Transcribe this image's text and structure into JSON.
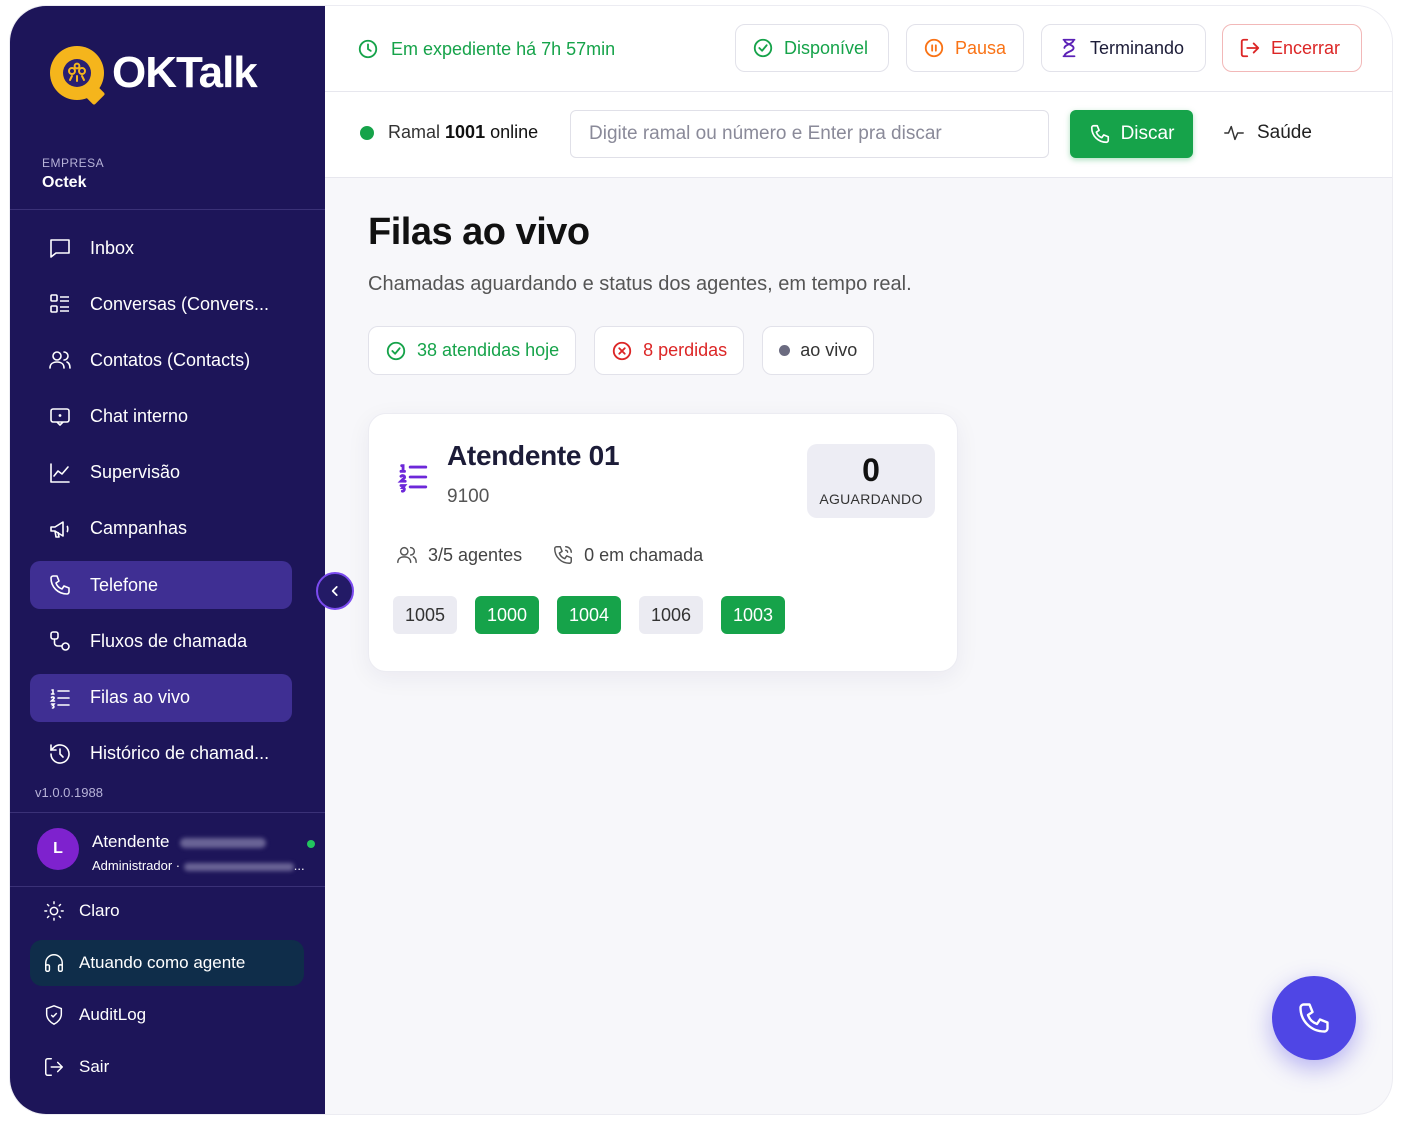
{
  "brand": {
    "name": "OKTalk"
  },
  "company": {
    "label": "EMPRESA",
    "name": "Octek"
  },
  "sidebar": {
    "items": [
      {
        "label": "Inbox",
        "icon": "message-square-icon",
        "active": false
      },
      {
        "label": "Conversas (Convers...",
        "icon": "list-grid-icon",
        "active": false
      },
      {
        "label": "Contatos (Contacts)",
        "icon": "users-icon",
        "active": false
      },
      {
        "label": "Chat interno",
        "icon": "chat-bubble-icon",
        "active": false
      },
      {
        "label": "Supervisão",
        "icon": "line-chart-icon",
        "active": false
      },
      {
        "label": "Campanhas",
        "icon": "megaphone-icon",
        "active": false
      },
      {
        "label": "Telefone",
        "icon": "phone-icon",
        "active": true
      },
      {
        "label": "Fluxos de chamada",
        "icon": "route-icon",
        "active": false
      },
      {
        "label": "Filas ao vivo",
        "icon": "list-ordered-icon",
        "active": true
      },
      {
        "label": "Histórico de chamad...",
        "icon": "history-icon",
        "active": false
      }
    ],
    "version": "v1.0.0.1988"
  },
  "user": {
    "initial": "L",
    "name": "Atendente",
    "role": "Administrador ·",
    "role_suffix": "..."
  },
  "bottom_nav": {
    "theme": "Claro",
    "agent_mode": "Atuando como agente",
    "audit": "AuditLog",
    "logout": "Sair"
  },
  "topbar": {
    "shift": "Em expediente há 7h 57min",
    "available": "Disponível",
    "pause": "Pausa",
    "finishing": "Terminando",
    "end": "Encerrar"
  },
  "dialbar": {
    "ramal_prefix": "Ramal",
    "ramal_number": "1001",
    "ramal_status": "online",
    "input_placeholder": "Digite ramal ou número e Enter pra discar",
    "input_value": "",
    "dial": "Discar",
    "health": "Saúde"
  },
  "page": {
    "title": "Filas ao vivo",
    "subtitle": "Chamadas aguardando e status dos agentes, em tempo real."
  },
  "chips": {
    "answered": "38 atendidas hoje",
    "missed": "8 perdidas",
    "live": "ao vivo"
  },
  "queue": {
    "name": "Atendente 01",
    "number": "9100",
    "waiting": "0",
    "waiting_label": "AGUARDANDO",
    "agents": "3/5 agentes",
    "in_call": "0 em chamada",
    "extensions": [
      {
        "ext": "1005",
        "state": "idle"
      },
      {
        "ext": "1000",
        "state": "busy"
      },
      {
        "ext": "1004",
        "state": "busy"
      },
      {
        "ext": "1006",
        "state": "idle"
      },
      {
        "ext": "1003",
        "state": "busy"
      }
    ]
  },
  "colors": {
    "sidebar_bg": "#1d1559",
    "active_item": "#3f2f93",
    "green": "#16a34a",
    "orange": "#f97316",
    "red": "#dc2626",
    "purple": "#6d28d9",
    "fab": "#4f46e5",
    "logo": "#f5b51c"
  }
}
